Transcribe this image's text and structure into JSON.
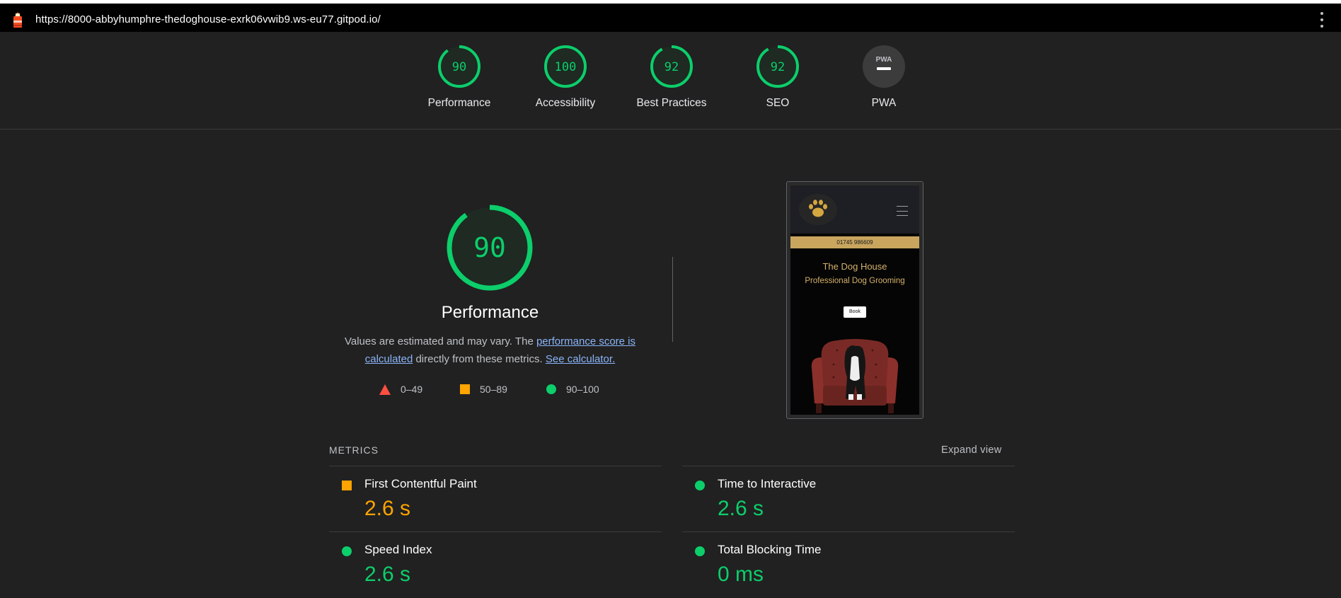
{
  "url_bar": {
    "url": "https://8000-abbyhumphre-thedoghouse-exrk06vwib9.ws-eu77.gitpod.io/"
  },
  "categories": [
    {
      "score": "90",
      "label": "Performance",
      "value": 90,
      "color": "#0cce6b"
    },
    {
      "score": "100",
      "label": "Accessibility",
      "value": 100,
      "color": "#0cce6b"
    },
    {
      "score": "92",
      "label": "Best Practices",
      "value": 92,
      "color": "#0cce6b"
    },
    {
      "score": "92",
      "label": "SEO",
      "value": 92,
      "color": "#0cce6b"
    },
    {
      "score": "",
      "label": "PWA",
      "badge": "PWA"
    }
  ],
  "performance": {
    "score": "90",
    "title": "Performance",
    "description_pre": "Values are estimated and may vary. The ",
    "link1": "performance score is calculated",
    "description_mid": " directly from these metrics. ",
    "link2": "See calculator.",
    "legend": [
      "0–49",
      "50–89",
      "90–100"
    ]
  },
  "screenshot": {
    "phone": "01745 986609",
    "title": "The Dog House",
    "subtitle": "Professional Dog Grooming",
    "button": "Book"
  },
  "metrics": {
    "heading": "METRICS",
    "expand": "Expand view",
    "items": [
      {
        "name": "First Contentful Paint",
        "value": "2.6 s",
        "status": "average"
      },
      {
        "name": "Time to Interactive",
        "value": "2.6 s",
        "status": "pass"
      },
      {
        "name": "Speed Index",
        "value": "2.6 s",
        "status": "pass"
      },
      {
        "name": "Total Blocking Time",
        "value": "0 ms",
        "status": "pass"
      }
    ]
  },
  "colors": {
    "pass": "#0cce6b",
    "average": "#ffa400",
    "fail": "#ff4e42",
    "background": "#212121"
  }
}
